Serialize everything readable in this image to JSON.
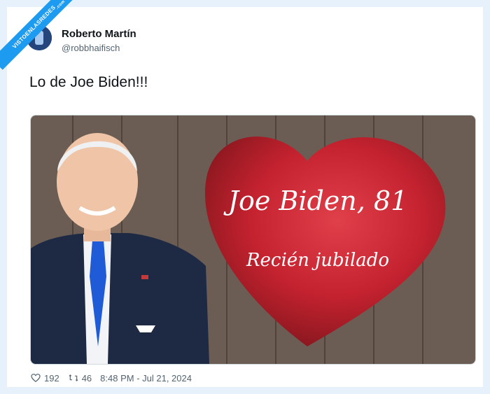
{
  "watermark": {
    "brand": "VISTOENLASREDES",
    "suffix": ".com"
  },
  "tweet": {
    "author_name": "Roberto Martín",
    "author_handle": "@robbhaifisch",
    "text": "Lo de Joe Biden!!!",
    "likes": "192",
    "retweets": "46",
    "timestamp": "8:48 PM - Jul 21, 2024"
  },
  "media": {
    "overlay_title": "Joe Biden, 81",
    "overlay_subtitle": "Recién jubilado",
    "colors": {
      "heart": "#c4222f",
      "wood": "#6b5d54",
      "suit": "#1e2a44",
      "tie": "#1f5bd6"
    }
  },
  "icons": {
    "like": "heart-icon",
    "retweet": "retweet-icon"
  }
}
